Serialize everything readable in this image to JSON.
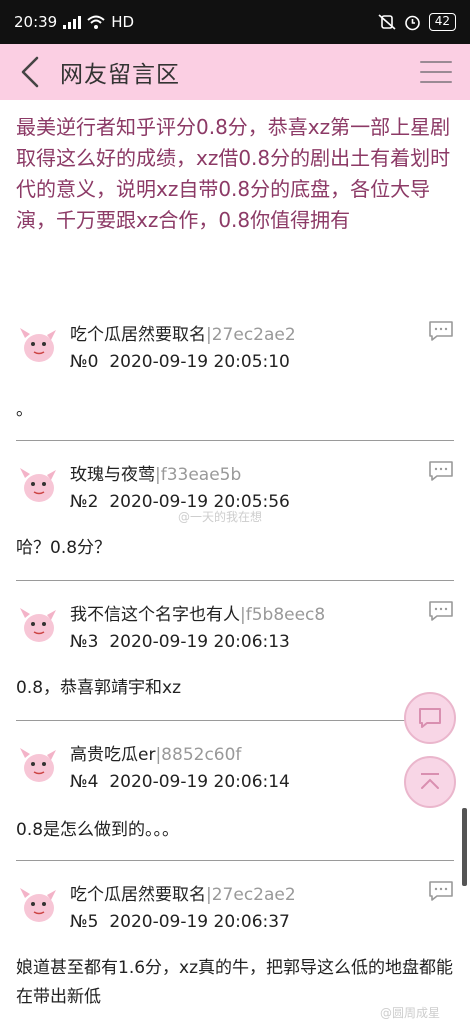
{
  "status_bar": {
    "time": "20:39",
    "network": "HD",
    "battery": "42"
  },
  "header": {
    "title": "网友留言区"
  },
  "post": {
    "text": "最美逆行者知乎评分0.8分，恭喜xz第一部上星剧取得这么好的成绩，xz借0.8分的剧出土有着划时代的意义，说明xz自带0.8分的底盘，各位大导演，千万要跟xz合作，0.8你值得拥有"
  },
  "comments": [
    {
      "name": "吃个瓜居然要取名",
      "hash": "|27ec2ae2",
      "number": "№0",
      "datetime": "2020-09-19 20:05:10",
      "body": "。"
    },
    {
      "name": "玫瑰与夜莺",
      "hash": "|f33eae5b",
      "number": "№2",
      "datetime": "2020-09-19 20:05:56",
      "body": "哈？0.8分？"
    },
    {
      "name": "我不信这个名字也有人",
      "hash": "|f5b8eec8",
      "number": "№3",
      "datetime": "2020-09-19 20:06:13",
      "body": "0.8，恭喜郭靖宇和xz"
    },
    {
      "name": "高贵吃瓜er",
      "hash": "|8852c60f",
      "number": "№4",
      "datetime": "2020-09-19 20:06:14",
      "body": "0.8是怎么做到的。。。"
    },
    {
      "name": "吃个瓜居然要取名",
      "hash": "|27ec2ae2",
      "number": "№5",
      "datetime": "2020-09-19 20:06:37",
      "body": "娘道甚至都有1.6分，xz真的牛，把郭导这么低的地盘都能在带出新低"
    }
  ],
  "watermarks": {
    "middle": "@一天的我在想",
    "bottom": "@圆周成星"
  },
  "colors": {
    "header_bg": "#fbcfe3",
    "post_text": "#8c3a66",
    "fab_bg": "#f8d6e6"
  },
  "icons": [
    "back-arrow-icon",
    "menu-icon",
    "comment-bubble-icon",
    "chat-icon",
    "scroll-top-icon",
    "avatar-icon"
  ]
}
